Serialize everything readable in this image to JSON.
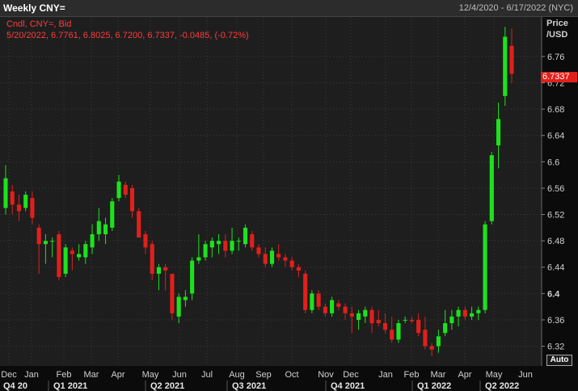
{
  "header": {
    "title": "Weekly CNY=",
    "date_range": "12/4/2020 - 6/17/2022 (NYC)"
  },
  "legend": {
    "line1": "Cndl, CNY=, Bid",
    "line2": "5/20/2022, 6.7761, 6.8025, 6.7200, 6.7337, -0.0485, (-0.72%)"
  },
  "axis": {
    "price_title_1": "Price",
    "price_title_2": "/USD",
    "last_price_label": "6.7337",
    "auto_button": "Auto"
  },
  "colors": {
    "background": "#1e1e1e",
    "up": "#1de21d",
    "down": "#e0201b",
    "grid": "#3a3a3a",
    "text": "#d0d0d0"
  },
  "chart_data": {
    "type": "candlestick",
    "title": "Weekly CNY=",
    "ylabel": "Price /USD",
    "ylim": [
      6.29,
      6.82
    ],
    "y_ticks": [
      6.32,
      6.36,
      6.4,
      6.44,
      6.48,
      6.52,
      6.56,
      6.6,
      6.64,
      6.68,
      6.72,
      6.76
    ],
    "x_month_labels": [
      "Dec",
      "Jan",
      "Feb",
      "Mar",
      "Apr",
      "May",
      "Jun",
      "Jul",
      "Aug",
      "Sep",
      "Oct",
      "Nov",
      "Dec",
      "Jan",
      "Feb",
      "Mar",
      "Apr",
      "May",
      "Jun"
    ],
    "x_quarter_labels": [
      "Q4 20",
      "Q1 2021",
      "Q2 2021",
      "Q3 2021",
      "Q4 2021",
      "Q1 2022",
      "Q2 2022"
    ],
    "grid": true,
    "candles": [
      {
        "o": 6.53,
        "h": 6.595,
        "l": 6.52,
        "c": 6.575
      },
      {
        "o": 6.555,
        "h": 6.565,
        "l": 6.52,
        "c": 6.535
      },
      {
        "o": 6.535,
        "h": 6.55,
        "l": 6.51,
        "c": 6.525
      },
      {
        "o": 6.53,
        "h": 6.555,
        "l": 6.525,
        "c": 6.55
      },
      {
        "o": 6.545,
        "h": 6.555,
        "l": 6.505,
        "c": 6.515
      },
      {
        "o": 6.5,
        "h": 6.505,
        "l": 6.43,
        "c": 6.475
      },
      {
        "o": 6.475,
        "h": 6.49,
        "l": 6.445,
        "c": 6.48
      },
      {
        "o": 6.48,
        "h": 6.485,
        "l": 6.455,
        "c": 6.48
      },
      {
        "o": 6.49,
        "h": 6.495,
        "l": 6.42,
        "c": 6.425
      },
      {
        "o": 6.43,
        "h": 6.475,
        "l": 6.425,
        "c": 6.47
      },
      {
        "o": 6.465,
        "h": 6.47,
        "l": 6.435,
        "c": 6.46
      },
      {
        "o": 6.455,
        "h": 6.475,
        "l": 6.45,
        "c": 6.46
      },
      {
        "o": 6.455,
        "h": 6.48,
        "l": 6.445,
        "c": 6.475
      },
      {
        "o": 6.47,
        "h": 6.505,
        "l": 6.46,
        "c": 6.49
      },
      {
        "o": 6.49,
        "h": 6.53,
        "l": 6.48,
        "c": 6.51
      },
      {
        "o": 6.49,
        "h": 6.515,
        "l": 6.475,
        "c": 6.505
      },
      {
        "o": 6.5,
        "h": 6.545,
        "l": 6.495,
        "c": 6.54
      },
      {
        "o": 6.545,
        "h": 6.58,
        "l": 6.54,
        "c": 6.57
      },
      {
        "o": 6.565,
        "h": 6.57,
        "l": 6.545,
        "c": 6.55
      },
      {
        "o": 6.56,
        "h": 6.565,
        "l": 6.515,
        "c": 6.525
      },
      {
        "o": 6.525,
        "h": 6.53,
        "l": 6.485,
        "c": 6.485
      },
      {
        "o": 6.49,
        "h": 6.495,
        "l": 6.46,
        "c": 6.47
      },
      {
        "o": 6.475,
        "h": 6.48,
        "l": 6.42,
        "c": 6.43
      },
      {
        "o": 6.43,
        "h": 6.445,
        "l": 6.405,
        "c": 6.44
      },
      {
        "o": 6.44,
        "h": 6.445,
        "l": 6.405,
        "c": 6.435
      },
      {
        "o": 6.43,
        "h": 6.43,
        "l": 6.36,
        "c": 6.37
      },
      {
        "o": 6.365,
        "h": 6.4,
        "l": 6.355,
        "c": 6.395
      },
      {
        "o": 6.39,
        "h": 6.405,
        "l": 6.38,
        "c": 6.395
      },
      {
        "o": 6.4,
        "h": 6.455,
        "l": 6.39,
        "c": 6.45
      },
      {
        "o": 6.45,
        "h": 6.49,
        "l": 6.445,
        "c": 6.455
      },
      {
        "o": 6.455,
        "h": 6.48,
        "l": 6.45,
        "c": 6.475
      },
      {
        "o": 6.47,
        "h": 6.485,
        "l": 6.455,
        "c": 6.48
      },
      {
        "o": 6.475,
        "h": 6.49,
        "l": 6.46,
        "c": 6.48
      },
      {
        "o": 6.48,
        "h": 6.49,
        "l": 6.455,
        "c": 6.465
      },
      {
        "o": 6.465,
        "h": 6.5,
        "l": 6.46,
        "c": 6.48
      },
      {
        "o": 6.48,
        "h": 6.485,
        "l": 6.465,
        "c": 6.48
      },
      {
        "o": 6.475,
        "h": 6.505,
        "l": 6.47,
        "c": 6.5
      },
      {
        "o": 6.49,
        "h": 6.495,
        "l": 6.465,
        "c": 6.47
      },
      {
        "o": 6.47,
        "h": 6.475,
        "l": 6.455,
        "c": 6.46
      },
      {
        "o": 6.46,
        "h": 6.47,
        "l": 6.44,
        "c": 6.445
      },
      {
        "o": 6.445,
        "h": 6.47,
        "l": 6.44,
        "c": 6.465
      },
      {
        "o": 6.46,
        "h": 6.475,
        "l": 6.45,
        "c": 6.455
      },
      {
        "o": 6.455,
        "h": 6.46,
        "l": 6.44,
        "c": 6.45
      },
      {
        "o": 6.45,
        "h": 6.455,
        "l": 6.435,
        "c": 6.44
      },
      {
        "o": 6.44,
        "h": 6.445,
        "l": 6.425,
        "c": 6.435
      },
      {
        "o": 6.43,
        "h": 6.435,
        "l": 6.37,
        "c": 6.375
      },
      {
        "o": 6.375,
        "h": 6.405,
        "l": 6.37,
        "c": 6.4
      },
      {
        "o": 6.4,
        "h": 6.405,
        "l": 6.375,
        "c": 6.38
      },
      {
        "o": 6.38,
        "h": 6.385,
        "l": 6.365,
        "c": 6.37
      },
      {
        "o": 6.37,
        "h": 6.395,
        "l": 6.365,
        "c": 6.39
      },
      {
        "o": 6.385,
        "h": 6.39,
        "l": 6.375,
        "c": 6.38
      },
      {
        "o": 6.38,
        "h": 6.385,
        "l": 6.36,
        "c": 6.37
      },
      {
        "o": 6.37,
        "h": 6.38,
        "l": 6.34,
        "c": 6.365
      },
      {
        "o": 6.36,
        "h": 6.375,
        "l": 6.345,
        "c": 6.37
      },
      {
        "o": 6.365,
        "h": 6.38,
        "l": 6.355,
        "c": 6.375
      },
      {
        "o": 6.375,
        "h": 6.38,
        "l": 6.34,
        "c": 6.355
      },
      {
        "o": 6.36,
        "h": 6.375,
        "l": 6.35,
        "c": 6.355
      },
      {
        "o": 6.355,
        "h": 6.37,
        "l": 6.34,
        "c": 6.345
      },
      {
        "o": 6.345,
        "h": 6.365,
        "l": 6.325,
        "c": 6.33
      },
      {
        "o": 6.33,
        "h": 6.36,
        "l": 6.325,
        "c": 6.355
      },
      {
        "o": 6.36,
        "h": 6.365,
        "l": 6.355,
        "c": 6.36
      },
      {
        "o": 6.36,
        "h": 6.365,
        "l": 6.355,
        "c": 6.358
      },
      {
        "o": 6.36,
        "h": 6.37,
        "l": 6.335,
        "c": 6.34
      },
      {
        "o": 6.345,
        "h": 6.365,
        "l": 6.315,
        "c": 6.32
      },
      {
        "o": 6.32,
        "h": 6.325,
        "l": 6.305,
        "c": 6.315
      },
      {
        "o": 6.32,
        "h": 6.345,
        "l": 6.31,
        "c": 6.335
      },
      {
        "o": 6.34,
        "h": 6.375,
        "l": 6.335,
        "c": 6.355
      },
      {
        "o": 6.355,
        "h": 6.375,
        "l": 6.345,
        "c": 6.365
      },
      {
        "o": 6.365,
        "h": 6.38,
        "l": 6.35,
        "c": 6.375
      },
      {
        "o": 6.375,
        "h": 6.38,
        "l": 6.36,
        "c": 6.365
      },
      {
        "o": 6.365,
        "h": 6.38,
        "l": 6.36,
        "c": 6.37
      },
      {
        "o": 6.37,
        "h": 6.38,
        "l": 6.36,
        "c": 6.375
      },
      {
        "o": 6.375,
        "h": 6.51,
        "l": 6.37,
        "c": 6.505
      },
      {
        "o": 6.51,
        "h": 6.615,
        "l": 6.505,
        "c": 6.61
      },
      {
        "o": 6.625,
        "h": 6.69,
        "l": 6.59,
        "c": 6.665
      },
      {
        "o": 6.7,
        "h": 6.805,
        "l": 6.685,
        "c": 6.79
      },
      {
        "o": 6.7761,
        "h": 6.8025,
        "l": 6.72,
        "c": 6.7337
      }
    ]
  }
}
